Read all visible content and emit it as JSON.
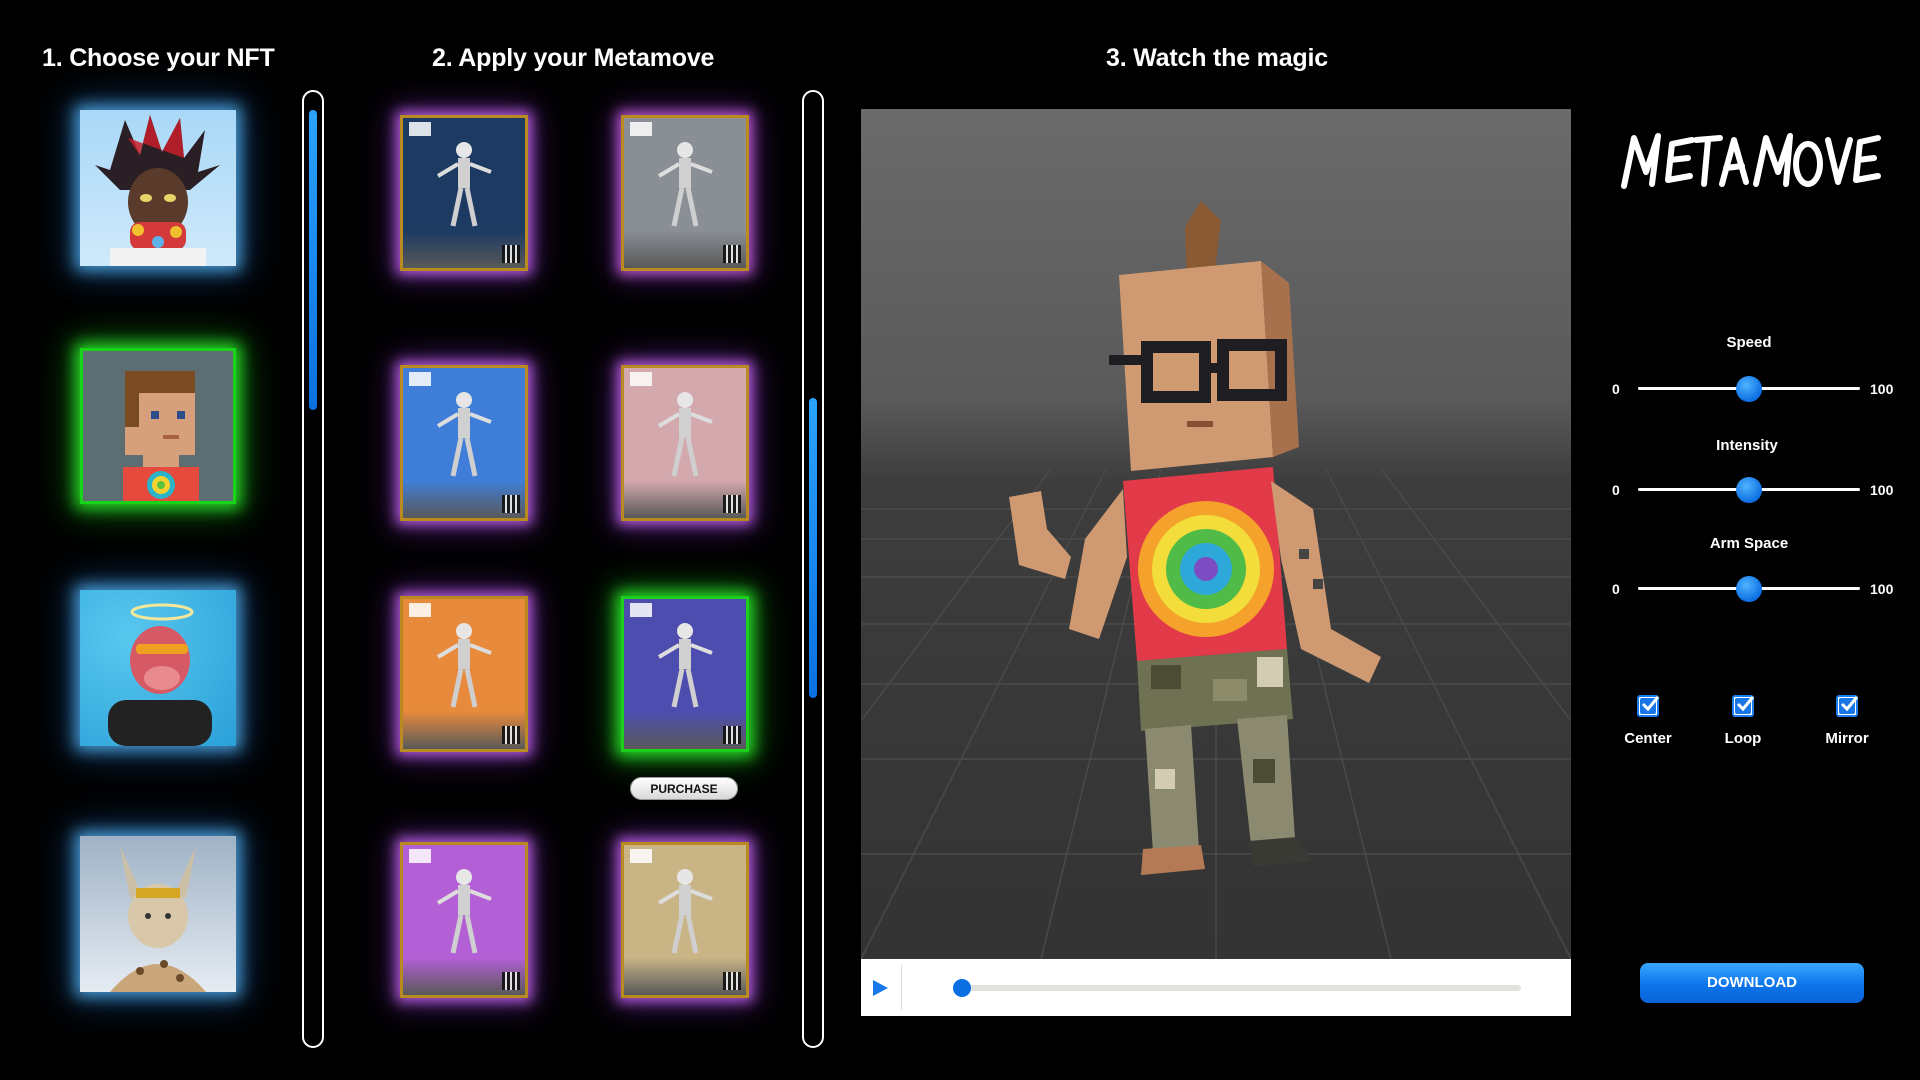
{
  "steps": {
    "choose_nft": "1. Choose your NFT",
    "apply_move": "2. Apply your Metamove",
    "watch": "3. Watch the magic"
  },
  "nfts": [
    {
      "name": "spiky-hair-avatar",
      "glow": "#5abfff"
    },
    {
      "name": "blocky-avatar",
      "glow": "#18d418",
      "selected": true
    },
    {
      "name": "halo-ape-avatar",
      "glow": "#5abfff"
    },
    {
      "name": "cat-avatar",
      "glow": "#5abfff"
    }
  ],
  "metamoves": [
    {
      "bg": "#1d3a63",
      "glow": "purple"
    },
    {
      "bg": "#8a8f96",
      "glow": "orange"
    },
    {
      "bg": "#3f7ed8",
      "glow": "purple"
    },
    {
      "bg": "#d4a9ad",
      "glow": "purple"
    },
    {
      "bg": "#e78a3c",
      "glow": "purple"
    },
    {
      "bg": "#4d4db0",
      "glow": "green",
      "selected": true
    },
    {
      "bg": "#b35fd6",
      "glow": "purple"
    },
    {
      "bg": "#c9b485",
      "glow": "purple"
    }
  ],
  "purchase_label": "PURCHASE",
  "logo_text": "MetaMoves",
  "sliders": [
    {
      "label": "Speed",
      "min": "0",
      "max": "100",
      "value": 50
    },
    {
      "label": "Intensity",
      "min": "0",
      "max": "100",
      "value": 50
    },
    {
      "label": "Arm Space",
      "min": "0",
      "max": "100",
      "value": 50
    }
  ],
  "options": [
    {
      "label": "Center",
      "checked": true
    },
    {
      "label": "Loop",
      "checked": true
    },
    {
      "label": "Mirror",
      "checked": true
    }
  ],
  "download_label": "DOWNLOAD",
  "player": {
    "progress": 0.0
  },
  "colors": {
    "accent": "#0c74ea",
    "nft_glow": "#5abfff",
    "selected_glow": "#18d418",
    "card_glow": "#c86cff"
  }
}
